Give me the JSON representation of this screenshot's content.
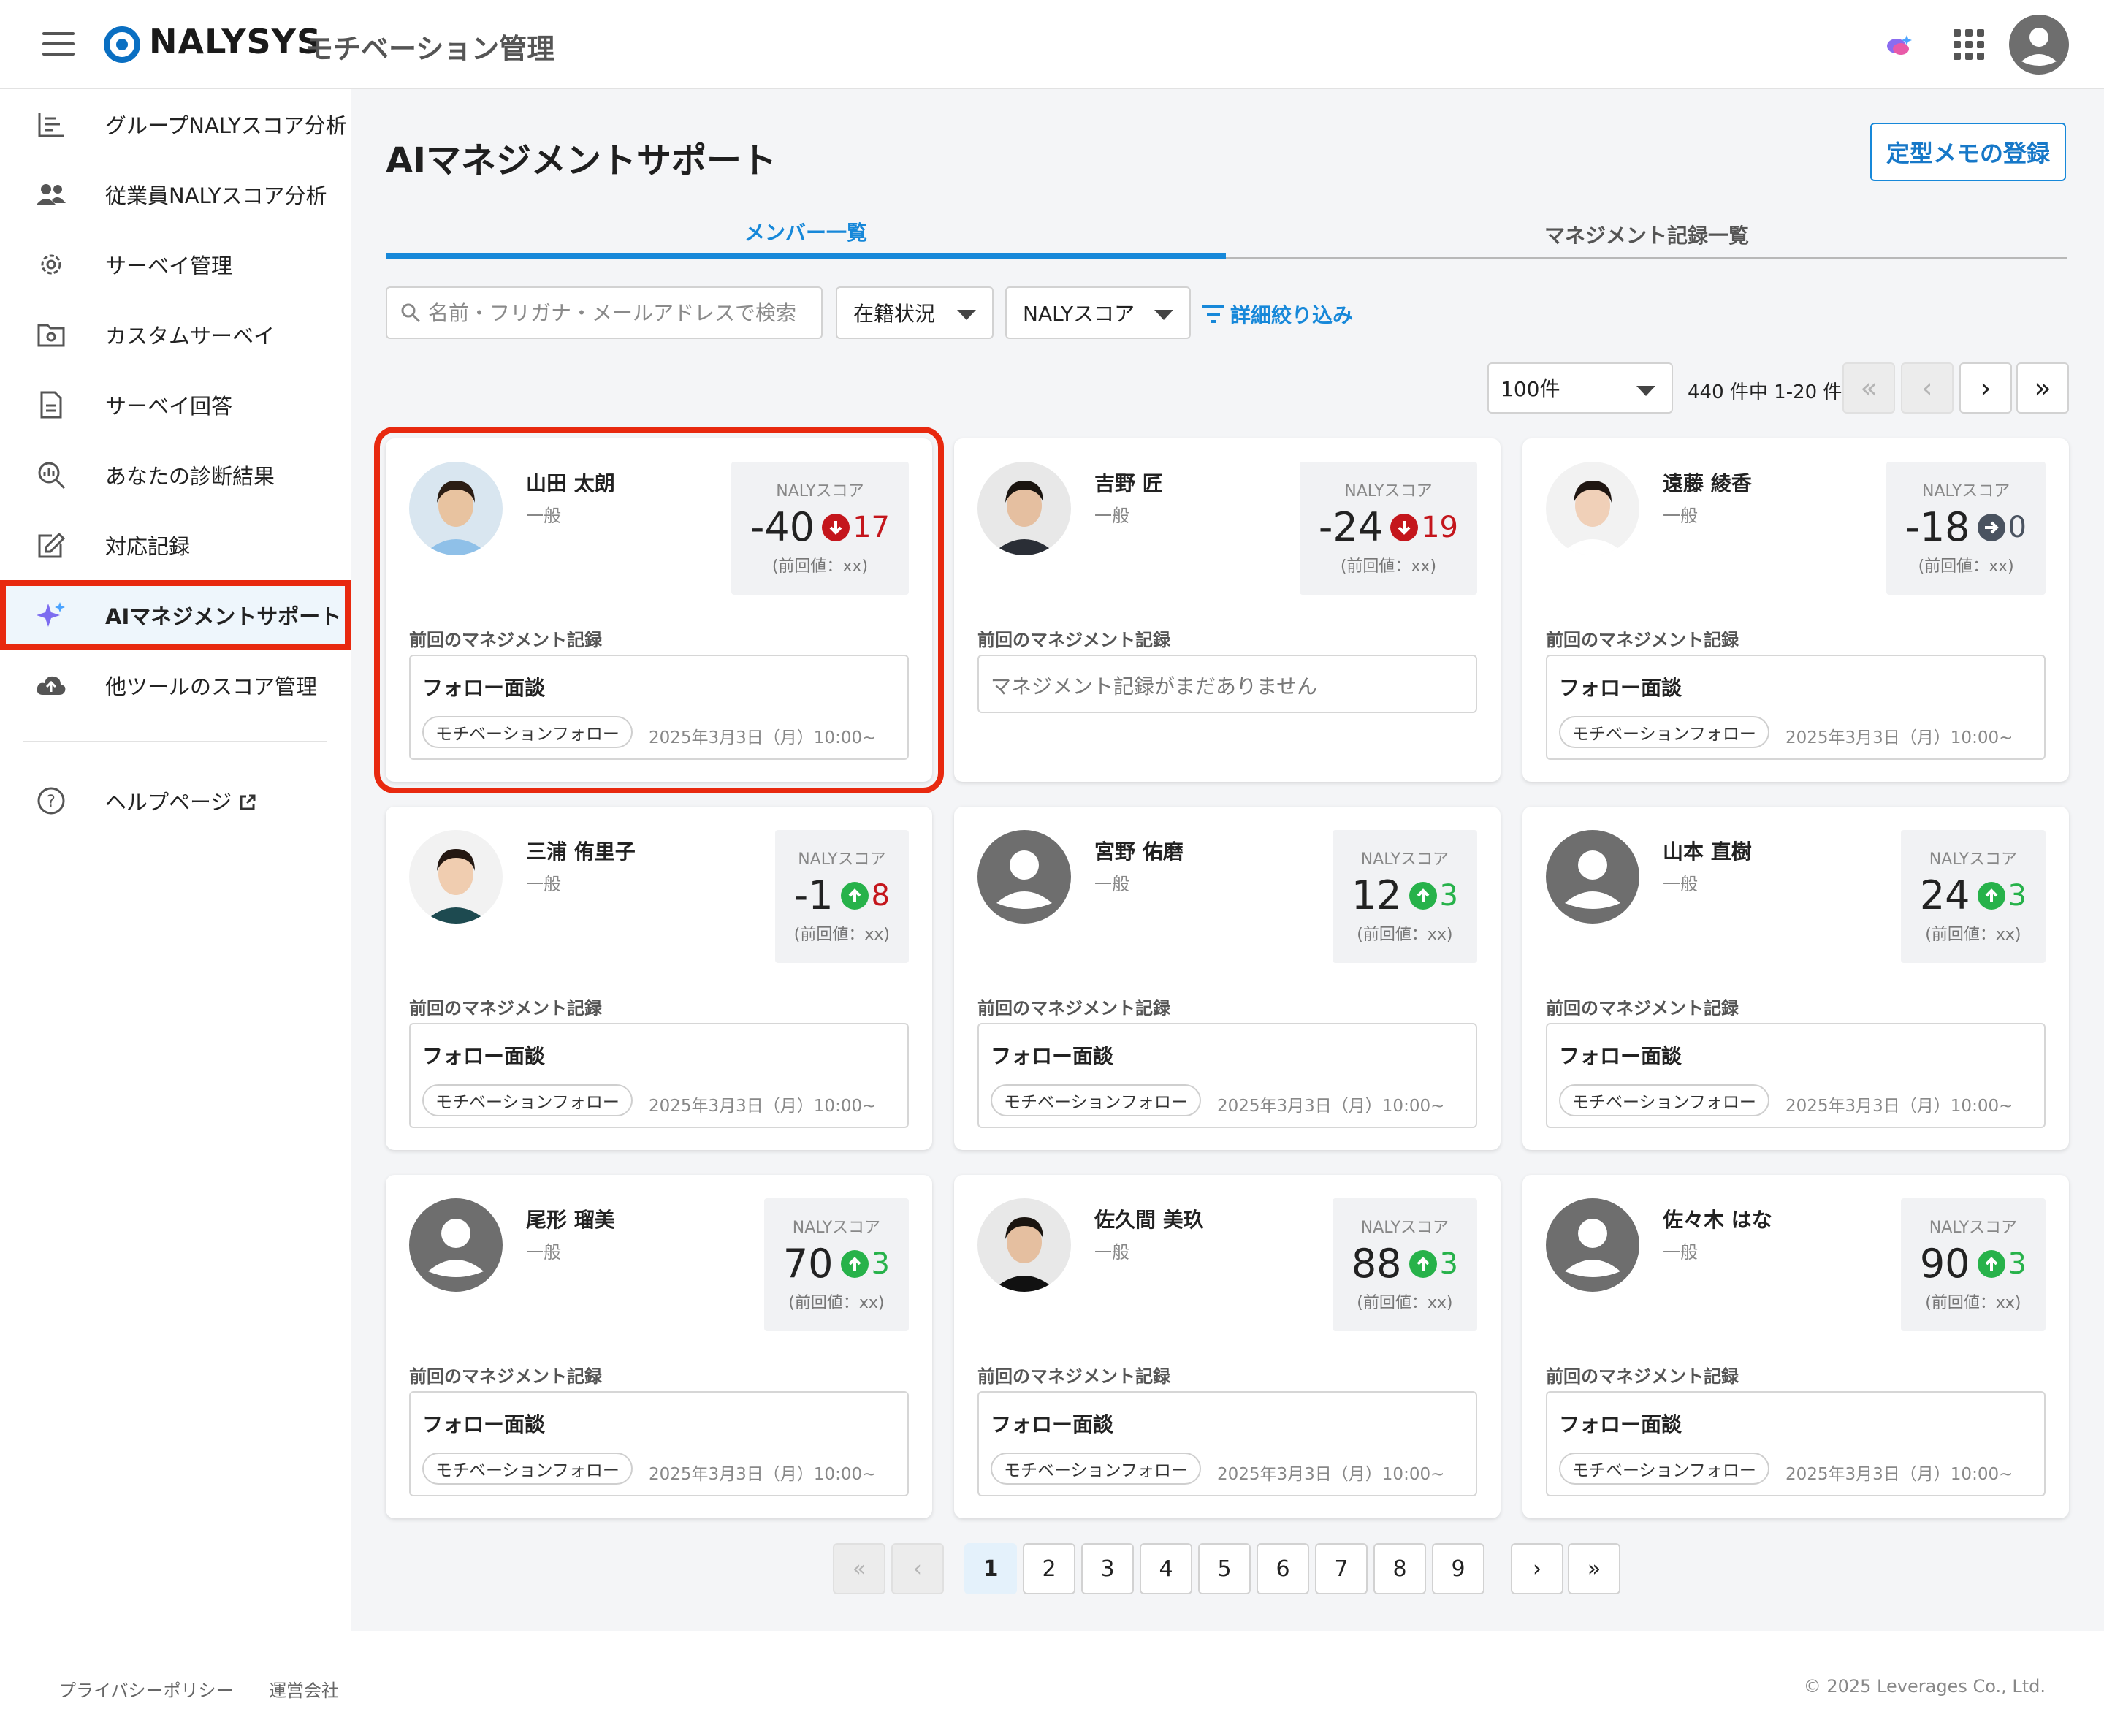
{
  "header": {
    "brand": "NALYSYS",
    "brand_sub": "モチベーション管理",
    "icons": [
      "menu-icon",
      "chat-sparkle-icon",
      "app-grid-icon",
      "user-avatar-icon"
    ]
  },
  "sidebar": {
    "items": [
      {
        "label": "グループNALYスコア分析",
        "icon": "bar-chart-icon"
      },
      {
        "label": "従業員NALYスコア分析",
        "icon": "people-icon"
      },
      {
        "label": "サーベイ管理",
        "icon": "gear-icon"
      },
      {
        "label": "カスタムサーベイ",
        "icon": "folder-gear-icon"
      },
      {
        "label": "サーベイ回答",
        "icon": "document-icon"
      },
      {
        "label": "あなたの診断結果",
        "icon": "search-chart-icon"
      },
      {
        "label": "対応記録",
        "icon": "edit-icon"
      },
      {
        "label": "AIマネジメントサポート",
        "icon": "sparkle-icon"
      },
      {
        "label": "他ツールのスコア管理",
        "icon": "cloud-upload-icon"
      }
    ],
    "help": {
      "label": "ヘルプページ",
      "icon": "help-circle-icon",
      "ext_icon": "external-link-icon"
    }
  },
  "main": {
    "title": "AIマネジメントサポート",
    "memo_button": "定型メモの登録",
    "tabs": [
      "メンバー一覧",
      "マネジメント記録一覧"
    ],
    "search_placeholder": "名前・フリガナ・メールアドレスで検索",
    "filter_status": "在籍状況",
    "filter_score": "NALYスコア",
    "filter_detail": "詳細絞り込み",
    "per_page": "100件",
    "range_text": "440 件中 1-20 件"
  },
  "common": {
    "score_label": "NALYスコア",
    "prev_label": "(前回値：xx)",
    "record_label": "前回のマネジメント記録"
  },
  "members": [
    {
      "name": "山田 太朗",
      "role": "一般",
      "score": "-40",
      "delta": "17",
      "trend": "down",
      "record_title": "フォロー面談",
      "record_tag": "モチベーションフォロー",
      "record_date": "2025年3月3日（月）10:00~"
    },
    {
      "name": "吉野 匠",
      "role": "一般",
      "score": "-24",
      "delta": "19",
      "trend": "down",
      "record_empty": "マネジメント記録がまだありません"
    },
    {
      "name": "遠藤 綾香",
      "role": "一般",
      "score": "-18",
      "delta": "0",
      "trend": "flat",
      "record_title": "フォロー面談",
      "record_tag": "モチベーションフォロー",
      "record_date": "2025年3月3日（月）10:00~"
    },
    {
      "name": "三浦 侑里子",
      "role": "一般",
      "score": "-1",
      "delta": "8",
      "trend": "up-red",
      "record_title": "フォロー面談",
      "record_tag": "モチベーションフォロー",
      "record_date": "2025年3月3日（月）10:00~"
    },
    {
      "name": "宮野 佑磨",
      "role": "一般",
      "score": "12",
      "delta": "3",
      "trend": "up",
      "record_title": "フォロー面談",
      "record_tag": "モチベーションフォロー",
      "record_date": "2025年3月3日（月）10:00~"
    },
    {
      "name": "山本 直樹",
      "role": "一般",
      "score": "24",
      "delta": "3",
      "trend": "up",
      "record_title": "フォロー面談",
      "record_tag": "モチベーションフォロー",
      "record_date": "2025年3月3日（月）10:00~"
    },
    {
      "name": "尾形 瑠美",
      "role": "一般",
      "score": "70",
      "delta": "3",
      "trend": "up",
      "record_title": "フォロー面談",
      "record_tag": "モチベーションフォロー",
      "record_date": "2025年3月3日（月）10:00~"
    },
    {
      "name": "佐久間 美玖",
      "role": "一般",
      "score": "88",
      "delta": "3",
      "trend": "up",
      "record_title": "フォロー面談",
      "record_tag": "モチベーションフォロー",
      "record_date": "2025年3月3日（月）10:00~"
    },
    {
      "name": "佐々木 はな",
      "role": "一般",
      "score": "90",
      "delta": "3",
      "trend": "up",
      "record_title": "フォロー面談",
      "record_tag": "モチベーションフォロー",
      "record_date": "2025年3月3日（月）10:00~"
    }
  ],
  "pagination": {
    "pages": [
      "1",
      "2",
      "3",
      "4",
      "5",
      "6",
      "7",
      "8",
      "9"
    ],
    "current": "1"
  },
  "footer": {
    "privacy": "プライバシーポリシー",
    "company": "運営会社",
    "copyright": "© 2025 Leverages Co., Ltd."
  },
  "colors": {
    "accent": "#1788d9",
    "highlight": "#e8290f",
    "down": "#c4161c",
    "up": "#27b24a",
    "flat": "#4a5360"
  }
}
